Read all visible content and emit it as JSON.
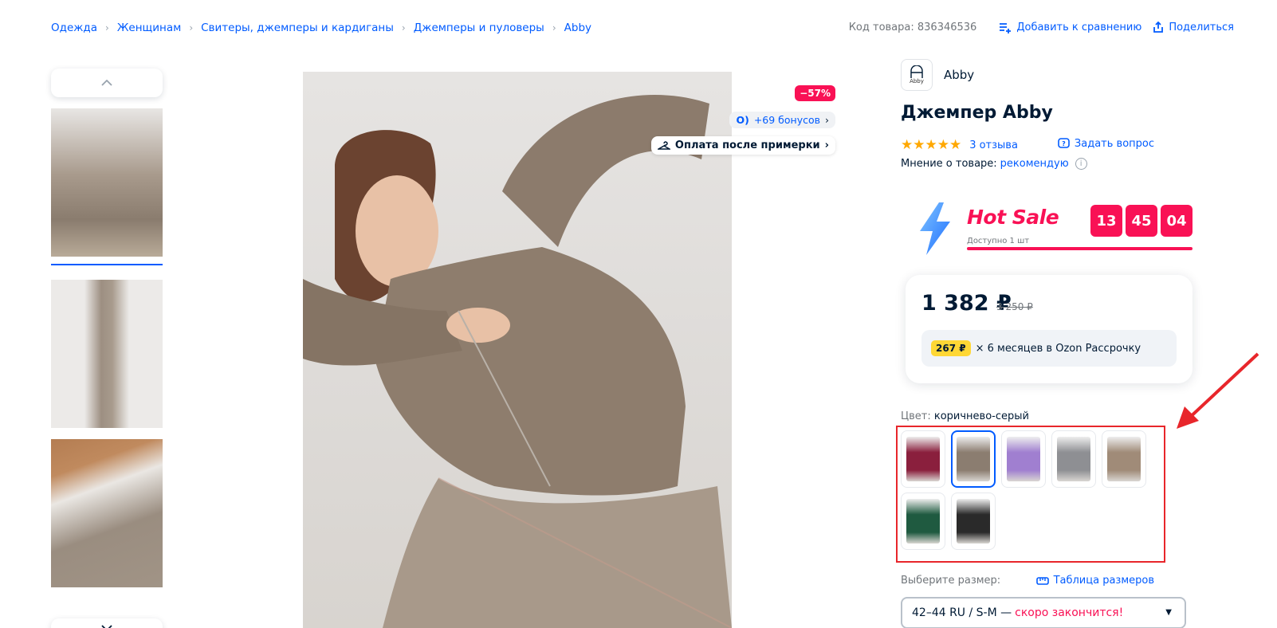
{
  "breadcrumb": [
    "Одежда",
    "Женщинам",
    "Свитеры, джемперы и кардиганы",
    "Джемперы и пуловеры",
    "Abby"
  ],
  "header": {
    "product_code": "Код товара: 836346536",
    "compare": "Добавить к сравнению",
    "share": "Поделиться"
  },
  "gallery": {
    "discount": "−57%",
    "bonus": "+69 бонусов",
    "pay_after": "Оплата после примерки"
  },
  "product": {
    "brand_logo_text": "Abby",
    "brand": "Abby",
    "title": "Джемпер Abby",
    "stars": "★★★★★",
    "rating": 5,
    "reviews": "3 отзыва",
    "ask_question": "Задать вопрос",
    "opinion_label": "Мнение о товаре:",
    "opinion_value": "рекомендую"
  },
  "hot_sale": {
    "title": "Hot Sale",
    "available": "Доступно 1 шт",
    "timer": [
      "13",
      "45",
      "04"
    ]
  },
  "price": {
    "current": "1 382 ₽",
    "old": "3 250 ₽",
    "installment_amount": "267 ₽",
    "installment_text": "× 6 месяцев в Ozon Рассрочку"
  },
  "color": {
    "label": "Цвет:",
    "value": "коричнево-серый",
    "swatches": [
      "#8a1f3d",
      "#8b7d70",
      "#a07fd0",
      "#8e8f93",
      "#a08b78",
      "#1f5a40",
      "#2a2a2a"
    ],
    "selected_index": 1
  },
  "size": {
    "label": "Выберите размер:",
    "table_link": "Таблица размеров",
    "selected": "42–44 RU / S-M —",
    "warning": "скоро закончится!"
  },
  "colors": {
    "accent": "#005bff",
    "sale": "#f91155",
    "annotation": "#e8262b"
  }
}
